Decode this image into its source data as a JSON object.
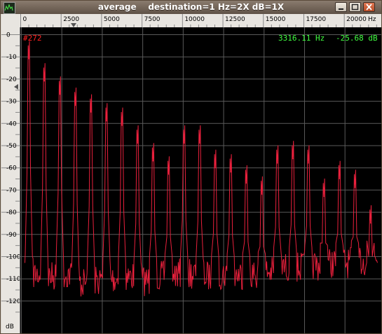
{
  "window": {
    "title": "average    destination=1 Hz=2X dB=1X",
    "buttons": [
      "minimize",
      "maximize",
      "close"
    ]
  },
  "readouts": {
    "sample": "#272",
    "frequency": "3316.11 Hz",
    "level": "-25.68 dB",
    "sample_color": "#ff2020",
    "value_color": "#40ff40"
  },
  "chart_data": {
    "type": "line",
    "xlabel": "Hz",
    "ylabel": "dB",
    "xlim": [
      0,
      22050
    ],
    "ylim": [
      -130,
      0
    ],
    "x_ticks": [
      "0",
      "2500",
      "5000",
      "7500",
      "10000",
      "12500",
      "15000",
      "17500",
      "20000",
      "Hz"
    ],
    "x_tick_values": [
      0,
      2500,
      5000,
      7500,
      10000,
      12500,
      15000,
      17500,
      20000
    ],
    "y_ticks": [
      "0",
      "-10",
      "-20",
      "-30",
      "-40",
      "-50",
      "-60",
      "-70",
      "-80",
      "-90",
      "-100",
      "-110",
      "-120",
      "dB"
    ],
    "y_tick_values": [
      0,
      -10,
      -20,
      -30,
      -40,
      -50,
      -60,
      -70,
      -80,
      -90,
      -100,
      -110,
      -120
    ],
    "grid": true,
    "line_color": "#e8203c",
    "series": [
      {
        "peaks_hz": [
          480,
          1440,
          2400,
          3360,
          4320,
          5280,
          6240,
          7200,
          8160,
          9120,
          10080,
          11040,
          12000,
          12960,
          13920,
          14880,
          15840,
          16800,
          17760,
          18720,
          19680,
          20640,
          21600
        ],
        "peaks_db": [
          -11,
          -21,
          -27,
          -32,
          -35,
          -39,
          -41,
          -49,
          -57,
          -63,
          -49,
          -49,
          -60,
          -62,
          -67,
          -72,
          -58,
          -56,
          -58,
          -73,
          -65,
          -69,
          -85
        ],
        "floor_db": [
          -103,
          -104,
          -103,
          -107,
          -106,
          -105,
          -104,
          -106,
          -104,
          -103,
          -103,
          -104,
          -103,
          -103,
          -103,
          -102,
          -100,
          -100,
          -99,
          -98,
          -98,
          -97,
          -97
        ]
      }
    ]
  }
}
